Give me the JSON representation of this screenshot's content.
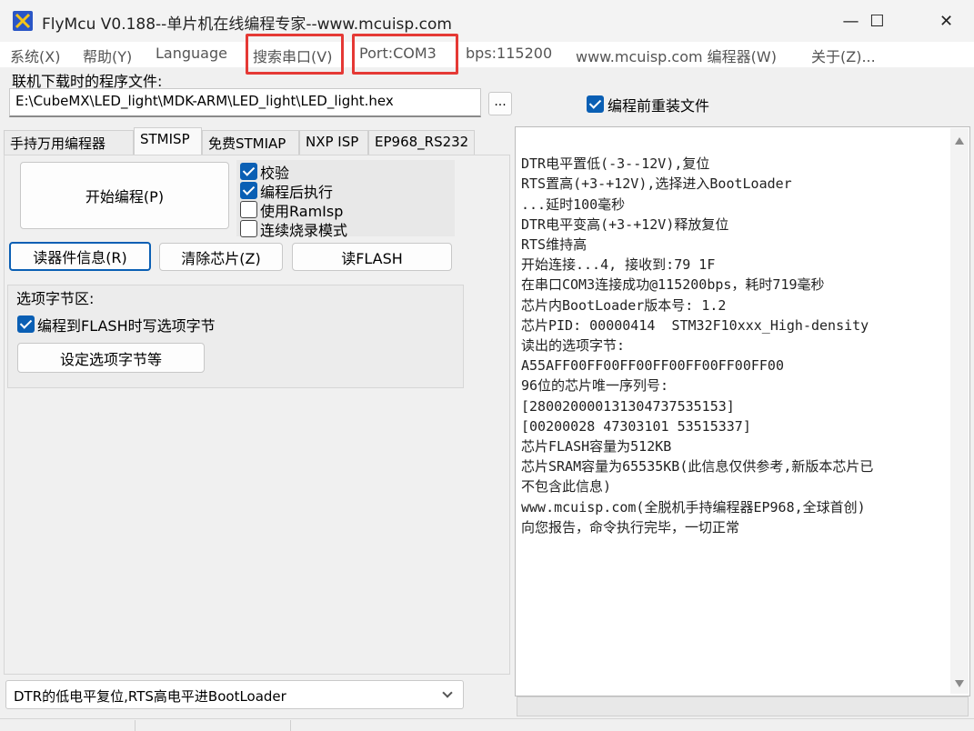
{
  "window": {
    "title": "FlyMcu V0.188--单片机在线编程专家--www.mcuisp.com",
    "minimize": "—",
    "maximize": "☐",
    "close": "✕"
  },
  "menu": {
    "system": "系统(X)",
    "help": "帮助(Y)",
    "language": "Language",
    "search_port": "搜索串口(V)",
    "port": "Port:COM3",
    "bps": "bps:115200",
    "programmer": "www.mcuisp.com 编程器(W)",
    "about": "关于(Z)..."
  },
  "file": {
    "label": "联机下载时的程序文件:",
    "path": "E:\\CubeMX\\LED_light\\MDK-ARM\\LED_light\\LED_light.hex",
    "browse": "...",
    "reload_label": "编程前重装文件",
    "reload_checked": true
  },
  "tabs": [
    "手持万用编程器",
    "STMISP",
    "免费STMIAP",
    "NXP ISP",
    "EP968_RS232"
  ],
  "active_tab": "STMISP",
  "stmisp": {
    "start_button": "开始编程(P)",
    "options": [
      {
        "label": "校验",
        "checked": true
      },
      {
        "label": "编程后执行",
        "checked": true
      },
      {
        "label": "使用RamIsp",
        "checked": false
      },
      {
        "label": "连续烧录模式",
        "checked": false
      }
    ],
    "read_info_button": "读器件信息(R)",
    "erase_button": "清除芯片(Z)",
    "read_flash_button": "读FLASH",
    "option_byte_group": "选项字节区:",
    "write_option_label": "编程到FLASH时写选项字节",
    "write_option_checked": true,
    "set_option_button": "设定选项字节等",
    "reset_mode": "DTR的低电平复位,RTS高电平进BootLoader"
  },
  "log": [
    "DTR电平置低(-3--12V),复位",
    "RTS置高(+3-+12V),选择进入BootLoader",
    "...延时100毫秒",
    "DTR电平变高(+3-+12V)释放复位",
    "RTS维持高",
    "开始连接...4, 接收到:79 1F",
    "在串口COM3连接成功@115200bps，耗时719毫秒",
    "芯片内BootLoader版本号: 1.2",
    "芯片PID: 00000414  STM32F10xxx_High-density",
    "读出的选项字节:",
    "A55AFF00FF00FF00FF00FF00FF00FF00",
    "96位的芯片唯一序列号:",
    "[280020000131304737535153]",
    "[00200028 47303101 53515337]",
    "芯片FLASH容量为512KB",
    "芯片SRAM容量为65535KB(此信息仅供参考,新版本芯片已",
    "不包含此信息)",
    "www.mcuisp.com(全脱机手持编程器EP968,全球首创)",
    "向您报告，命令执行完毕，一切正常"
  ],
  "colors": {
    "highlight_box": "#e53935",
    "checkbox_accent": "#0a5fb4",
    "app_icon": "#2a56c6"
  }
}
